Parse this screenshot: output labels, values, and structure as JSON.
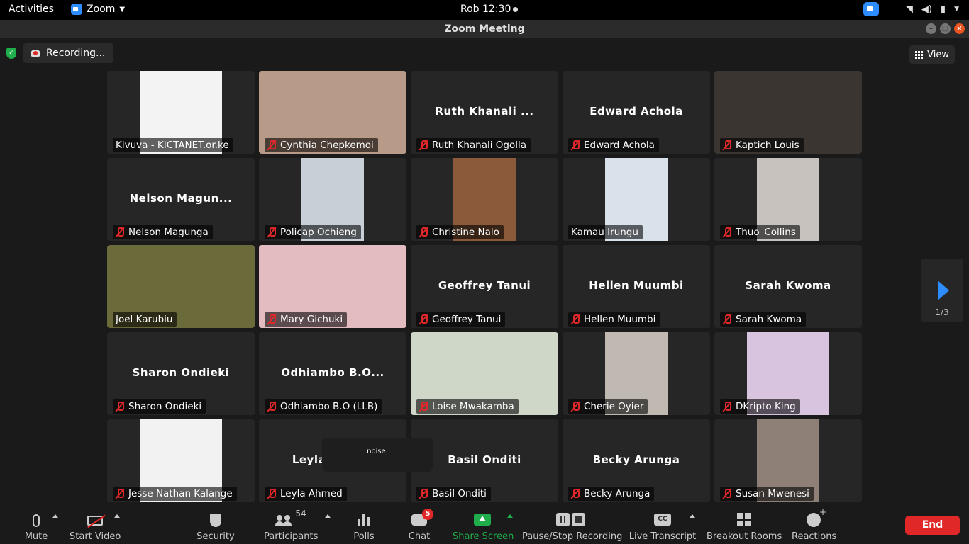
{
  "topbar": {
    "activities": "Activities",
    "app_name": "Zoom",
    "clock": "Rob 12:30"
  },
  "window": {
    "title": "Zoom Meeting"
  },
  "meeting": {
    "recording_label": "Recording...",
    "view_label": "View",
    "page_indicator": "1/3",
    "noise_tooltip": "noise."
  },
  "tiles": [
    {
      "big": "",
      "name": "Kivuva - KICTANET.or.ke",
      "muted": false,
      "video": "#f3f3f3"
    },
    {
      "big": "",
      "name": "Cynthia Chepkemoi",
      "muted": true,
      "video": "#b79a88"
    },
    {
      "big": "Ruth Khanali ...",
      "name": "Ruth Khanali Ogolla",
      "muted": true,
      "video": ""
    },
    {
      "big": "Edward Achola",
      "name": "Edward Achola",
      "muted": true,
      "video": ""
    },
    {
      "big": "",
      "name": "Kaptich Louis",
      "muted": true,
      "video": "#3a3530"
    },
    {
      "big": "Nelson Magun...",
      "name": "Nelson Magunga",
      "muted": true,
      "video": ""
    },
    {
      "big": "",
      "name": "Policap Ochieng",
      "muted": true,
      "video": "#c8cfd6"
    },
    {
      "big": "",
      "name": "Christine Nalo",
      "muted": true,
      "video": "#8a5a3a"
    },
    {
      "big": "",
      "name": "Kamau Irungu",
      "muted": false,
      "video": "#d9e1ea"
    },
    {
      "big": "",
      "name": "Thuo_Collins",
      "muted": true,
      "video": "#c7c2bd"
    },
    {
      "big": "",
      "name": "Joel Karubiu",
      "muted": false,
      "video": "#6b6a3a"
    },
    {
      "big": "",
      "name": "Mary Gichuki",
      "muted": true,
      "video": "#e3bcc2"
    },
    {
      "big": "Geoffrey Tanui",
      "name": "Geoffrey Tanui",
      "muted": true,
      "video": ""
    },
    {
      "big": "Hellen Muumbi",
      "name": "Hellen Muumbi",
      "muted": true,
      "video": ""
    },
    {
      "big": "Sarah Kwoma",
      "name": "Sarah Kwoma",
      "muted": true,
      "video": ""
    },
    {
      "big": "Sharon Ondieki",
      "name": "Sharon Ondieki",
      "muted": true,
      "video": ""
    },
    {
      "big": "Odhiambo B.O...",
      "name": "Odhiambo B.O (LLB)",
      "muted": true,
      "video": ""
    },
    {
      "big": "",
      "name": "Loise Mwakamba",
      "muted": true,
      "video": "#cfd7c9"
    },
    {
      "big": "",
      "name": "Cherie Oyier",
      "muted": true,
      "video": "#bfb9b2"
    },
    {
      "big": "",
      "name": "DKripto King",
      "muted": true,
      "video": "#d9c4e0"
    },
    {
      "big": "",
      "name": "Jesse Nathan Kalange",
      "muted": true,
      "video": "#f2f2f2"
    },
    {
      "big": "Leyla Ahmed",
      "name": "Leyla Ahmed",
      "muted": true,
      "video": ""
    },
    {
      "big": "Basil Onditi",
      "name": "Basil Onditi",
      "muted": true,
      "video": ""
    },
    {
      "big": "Becky Arunga",
      "name": "Becky Arunga",
      "muted": true,
      "video": ""
    },
    {
      "big": "",
      "name": "Susan Mwenesi",
      "muted": true,
      "video": "#8e7f77"
    }
  ],
  "toolbar": {
    "mute": "Mute",
    "start_video": "Start Video",
    "security": "Security",
    "participants": "Participants",
    "participants_count": "54",
    "polls": "Polls",
    "chat": "Chat",
    "chat_badge": "5",
    "share_screen": "Share Screen",
    "pause_stop_recording": "Pause/Stop Recording",
    "live_transcript": "Live Transcript",
    "cc": "CC",
    "breakout_rooms": "Breakout Rooms",
    "reactions": "Reactions",
    "end": "End"
  },
  "colors": {
    "accent": "#2d8cff",
    "end_red": "#e02828",
    "share_green": "#1fae4b"
  }
}
